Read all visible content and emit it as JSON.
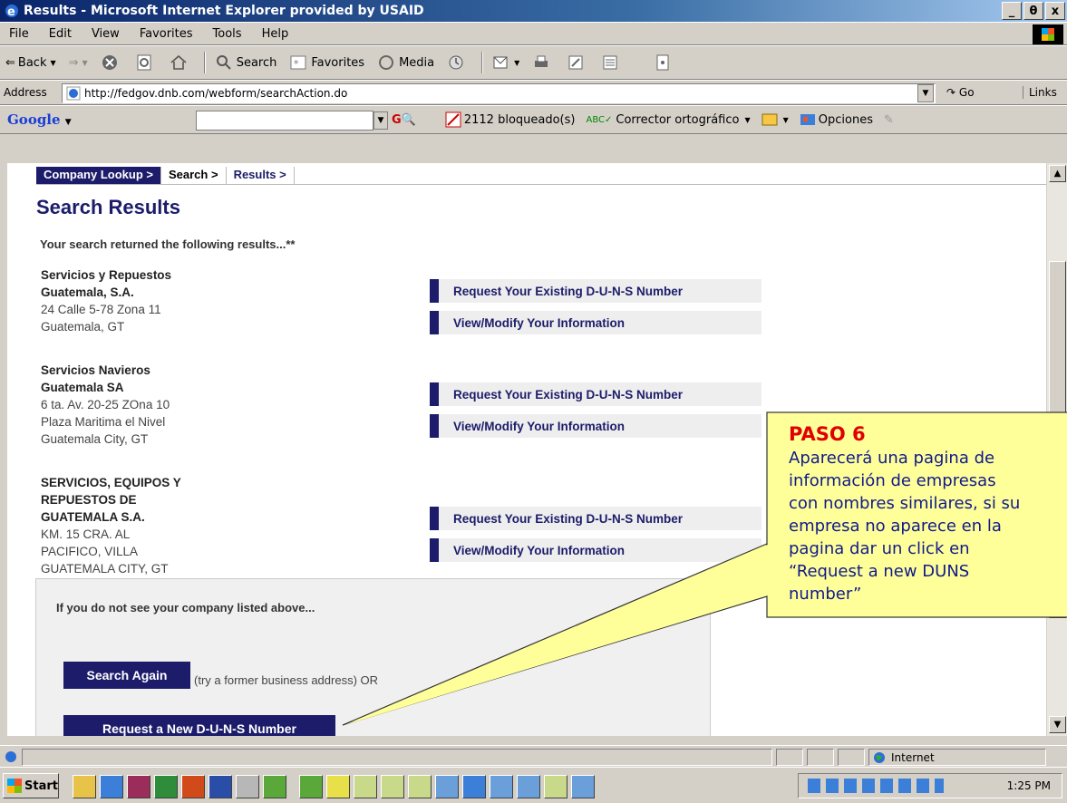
{
  "window": {
    "title": "Results - Microsoft Internet Explorer provided by USAID",
    "controls": [
      "_",
      "θ",
      "x"
    ]
  },
  "menu": [
    "File",
    "Edit",
    "View",
    "Favorites",
    "Tools",
    "Help"
  ],
  "toolbar": {
    "back": "Back",
    "search": "Search",
    "favorites": "Favorites",
    "media": "Media"
  },
  "address": {
    "label": "Address",
    "url": "http://fedgov.dnb.com/webform/searchAction.do",
    "go": "Go",
    "links": "Links"
  },
  "google": {
    "logo": "Google",
    "blocked": "2112 bloqueado(s)",
    "spell": "Corrector ortográfico",
    "options": "Opciones"
  },
  "page": {
    "breadcrumb": [
      "Company Lookup >",
      "Search >",
      "Results >"
    ],
    "title": "Search Results",
    "intro": "Your search returned the following results...**",
    "companies": [
      {
        "name_lines": [
          "Servicios y Repuestos",
          "Guatemala, S.A."
        ],
        "addr_lines": [
          "24 Calle 5-78 Zona 11",
          "Guatemala, GT"
        ]
      },
      {
        "name_lines": [
          "Servicios Navieros",
          "Guatemala SA"
        ],
        "addr_lines": [
          "6 ta. Av. 20-25 ZOna 10",
          "Plaza Maritima el Nivel",
          "Guatemala City, GT"
        ]
      },
      {
        "name_lines": [
          "SERVICIOS, EQUIPOS Y",
          "REPUESTOS DE",
          "GUATEMALA S.A."
        ],
        "addr_lines": [
          "KM. 15 CRA. AL",
          "PACIFICO, VILLA",
          "GUATEMALA CITY, GT"
        ]
      }
    ],
    "request_existing": "Request Your Existing D-U-N-S Number",
    "view_modify": "View/Modify Your Information",
    "not_found": "If you do not see your company listed above...",
    "search_again": "Search Again",
    "search_hint": "(try a former business address) OR",
    "request_new": "Request a New D-U-N-S Number"
  },
  "callout": {
    "title": "PASO 6",
    "lines": [
      "Aparecerá una pagina de",
      "información de empresas",
      "con nombres similares, si su",
      "empresa no aparece en la",
      "pagina dar un click en",
      "“Request a new DUNS",
      "number”"
    ]
  },
  "status": {
    "zone": "Internet"
  },
  "taskbar": {
    "start": "Start",
    "clock": "1:25 PM"
  },
  "colors": {
    "navy": "#1c1c6b",
    "callout_bg": "#ffff99",
    "callout_title": "#e00000",
    "callout_text": "#101a8a"
  }
}
